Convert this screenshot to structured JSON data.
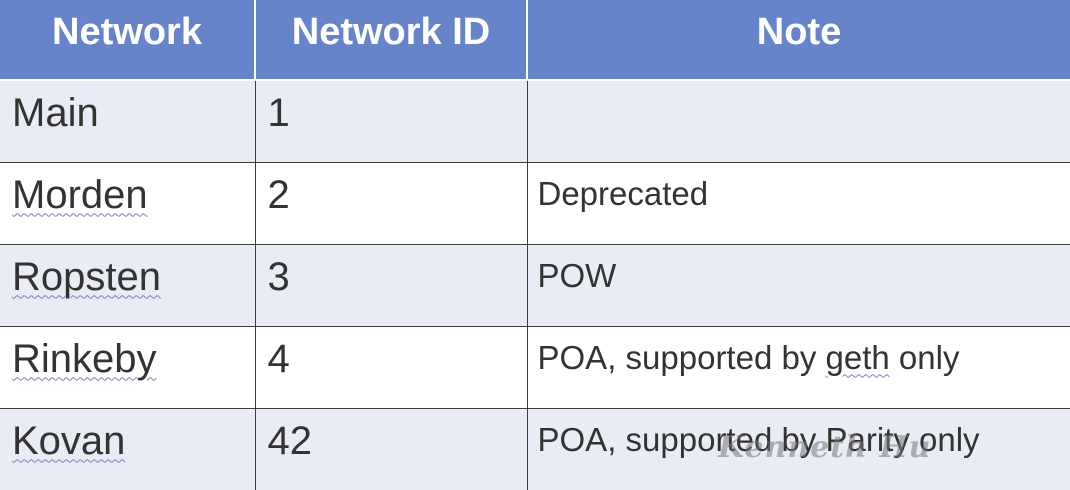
{
  "headers": [
    "Network",
    "Network ID",
    "Note"
  ],
  "rows": [
    {
      "network": "Main",
      "id": "1",
      "note": ""
    },
    {
      "network": "Morden",
      "id": "2",
      "note": "Deprecated"
    },
    {
      "network": "Ropsten",
      "id": "3",
      "note": "POW"
    },
    {
      "network": "Rinkeby",
      "id": "4",
      "note_pre": "POA, supported by ",
      "note_word": "geth",
      "note_post": " only"
    },
    {
      "network": "Kovan",
      "id": "42",
      "note": "POA, supported by Parity only"
    }
  ],
  "watermark": "Kenneth Hu",
  "colors": {
    "header_bg": "#6684c9",
    "row_alt_bg": "#e9ecf5",
    "row_bg": "#ffffff"
  }
}
